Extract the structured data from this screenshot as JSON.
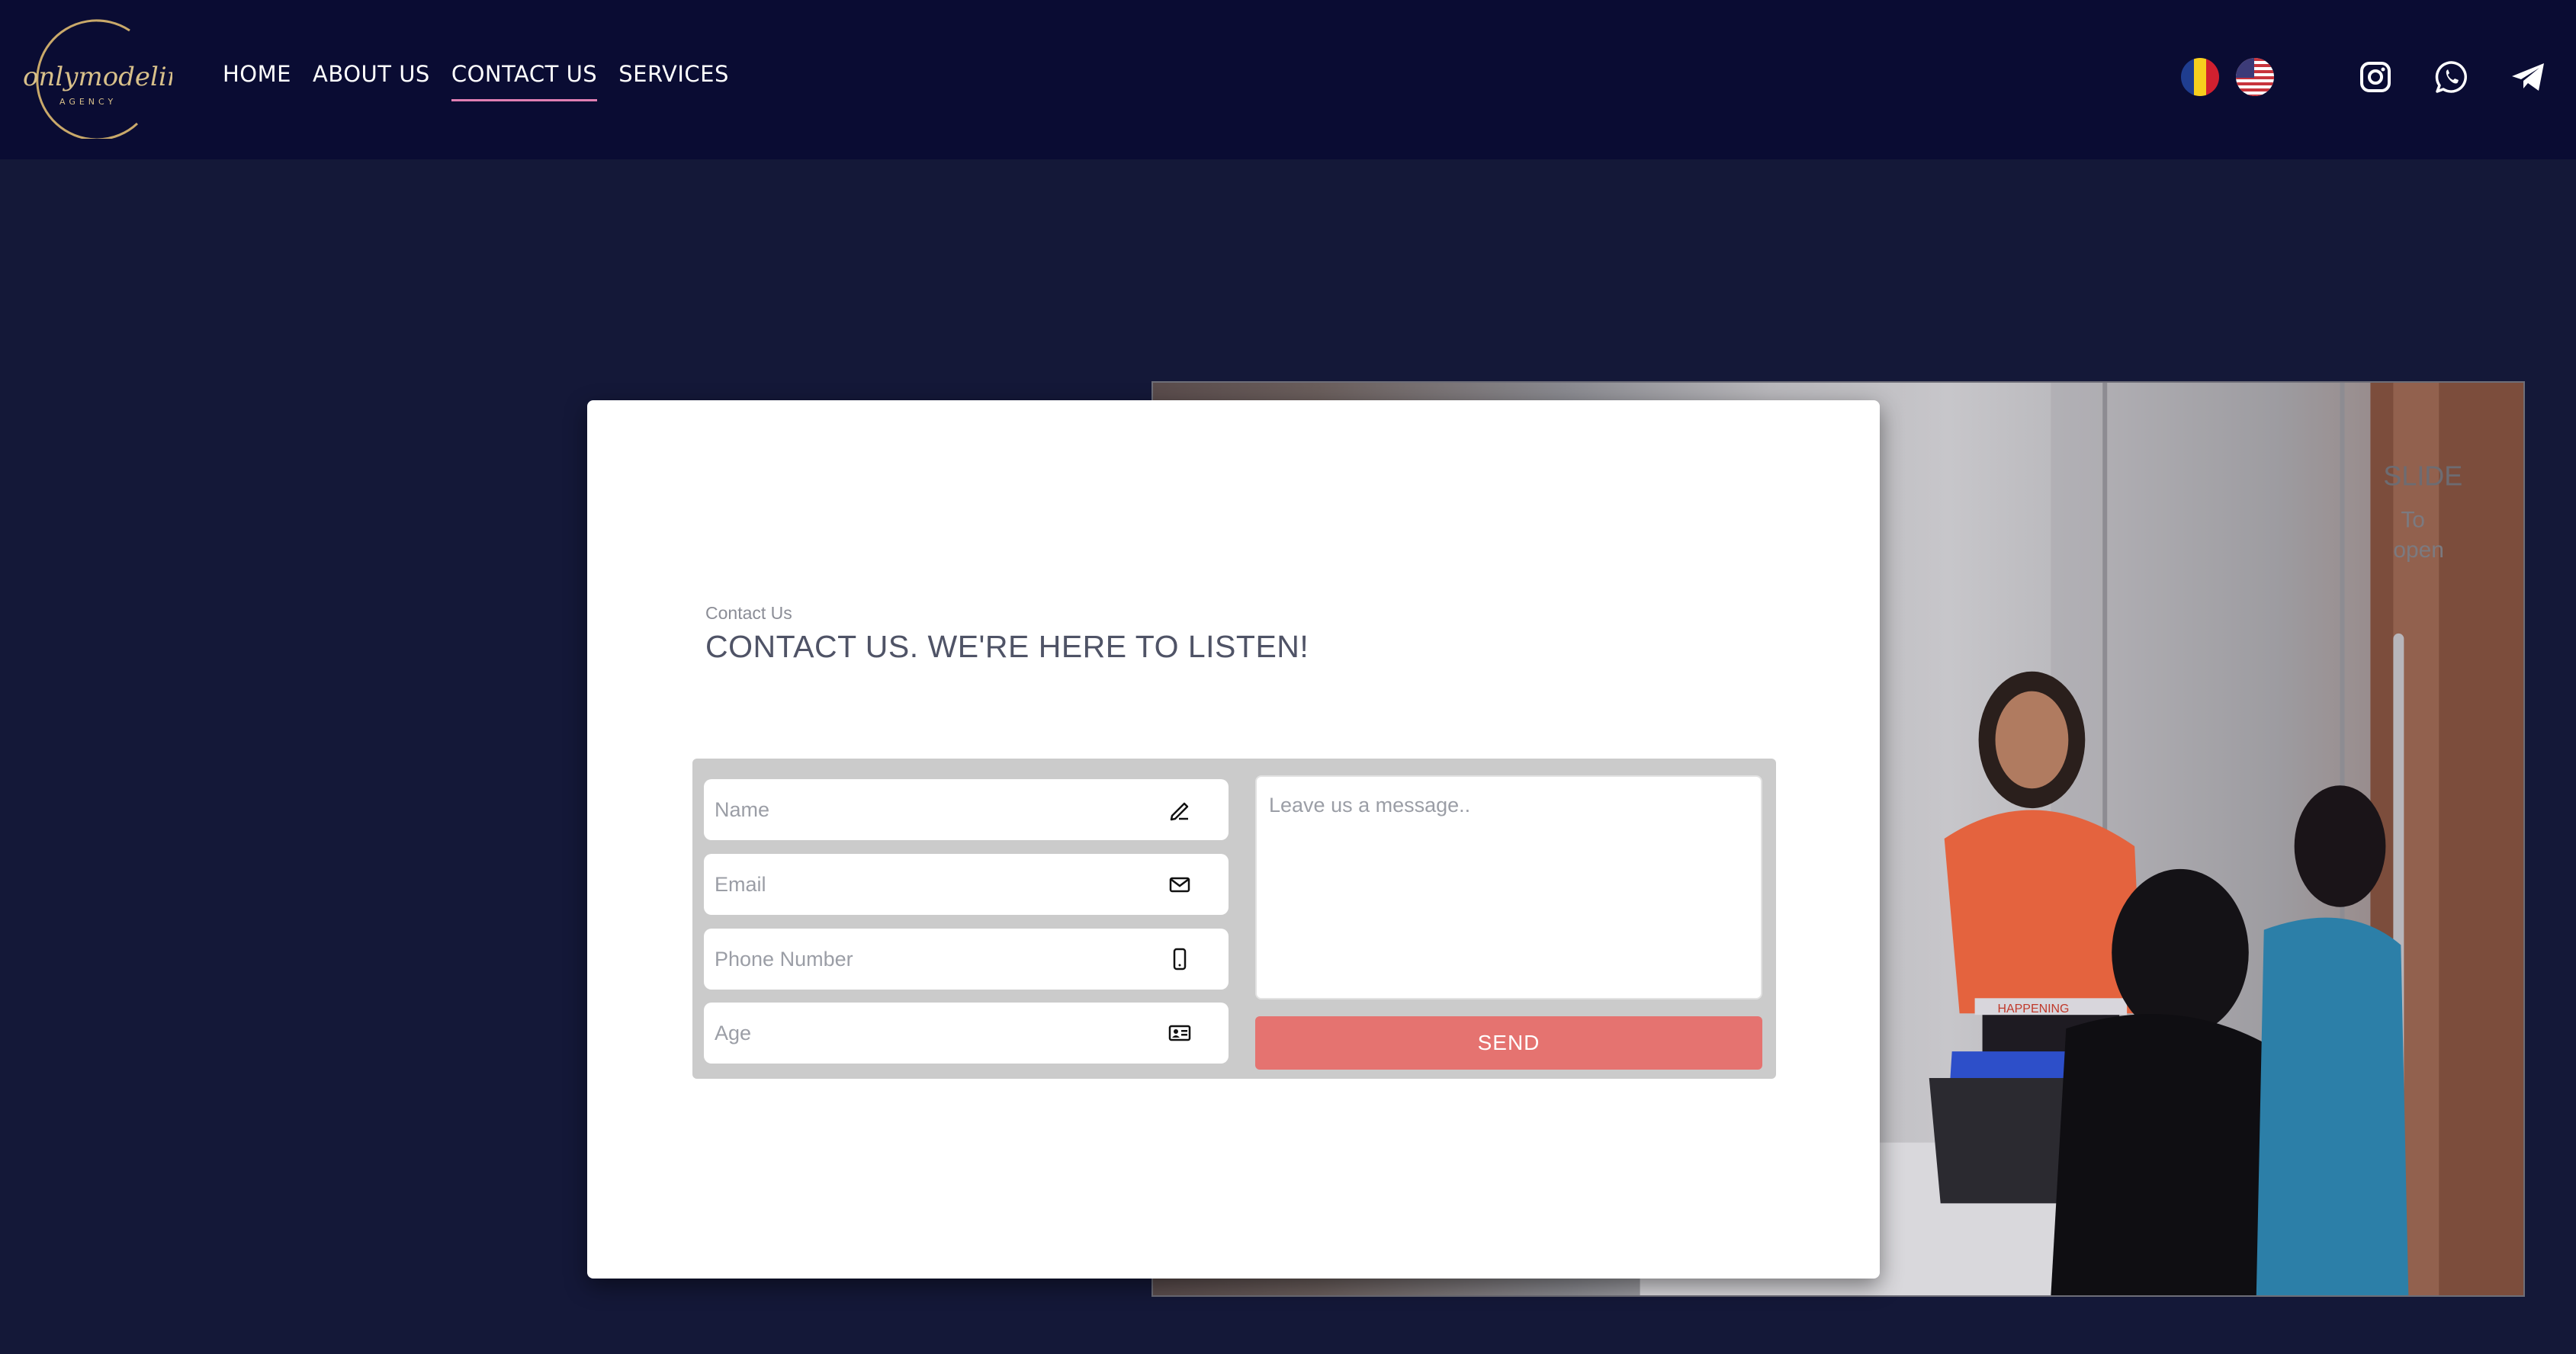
{
  "header": {
    "logo_text": "onlymodeling",
    "logo_subtext": "AGENCY",
    "nav": [
      {
        "label": "HOME",
        "active": false
      },
      {
        "label": "ABOUT US",
        "active": false
      },
      {
        "label": "CONTACT US",
        "active": true
      },
      {
        "label": "SERVICES",
        "active": false
      }
    ],
    "languages": [
      "romanian-flag-icon",
      "us-flag-icon"
    ],
    "social": [
      "instagram-icon",
      "whatsapp-icon",
      "telegram-icon"
    ]
  },
  "contact": {
    "eyebrow": "Contact Us",
    "heading": "CONTACT US. WE'RE HERE TO LISTEN!",
    "fields": [
      {
        "placeholder": "Name",
        "icon": "pen-icon"
      },
      {
        "placeholder": "Email",
        "icon": "envelope-icon"
      },
      {
        "placeholder": "Phone Number",
        "icon": "phone-icon"
      },
      {
        "placeholder": "Age",
        "icon": "id-card-icon"
      }
    ],
    "message_placeholder": "Leave us a message..",
    "send_label": "SEND"
  },
  "photo": {
    "sign_text": "SLIDE",
    "sign_subtext": "To",
    "sign_subtext2": "open",
    "shirt_text": "HAPPENING"
  },
  "colors": {
    "header_bg": "#0a0c33",
    "page_bg": "#141838",
    "accent": "#e07fb3",
    "send_button": "#e57370"
  }
}
